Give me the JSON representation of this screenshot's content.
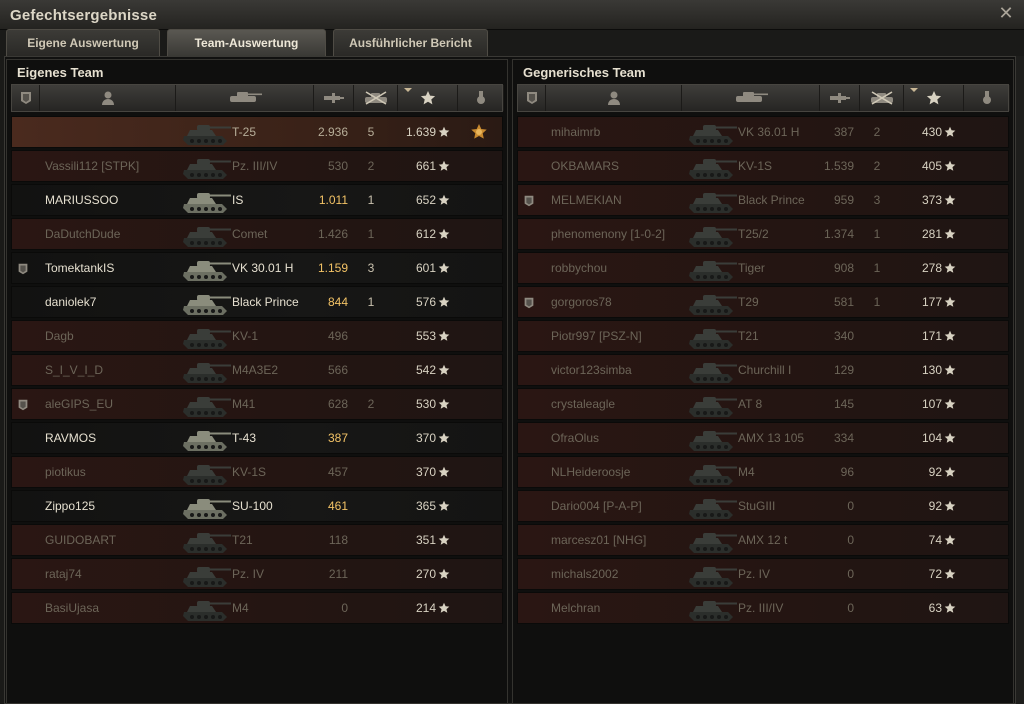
{
  "window": {
    "title": "Gefechtsergebnisse",
    "close_icon": "close-icon"
  },
  "tabs": [
    {
      "label": "Eigene Auswertung",
      "active": false
    },
    {
      "label": "Team-Auswertung",
      "active": true
    },
    {
      "label": "Ausführlicher Bericht",
      "active": false
    }
  ],
  "columns": [
    "badge-icon",
    "player-icon",
    "vehicle-icon",
    "damage-icon",
    "kills-icon",
    "xp-star-icon",
    "medal-icon"
  ],
  "colors": {
    "destroyed_row": "#2a1613",
    "alive_row": "#171716",
    "highlight_damage": "#f2c266",
    "panel_border": "#34332f"
  },
  "own_team": {
    "title": "Eigenes Team",
    "rows": [
      {
        "name": "",
        "vehicle": "T-25",
        "damage": "2.936",
        "kills": "5",
        "xp": "1.639",
        "status": "player",
        "badge": false,
        "medal": true,
        "dmg_hl": false
      },
      {
        "name": "Vassili112 [STPK]",
        "vehicle": "Pz. III/IV",
        "damage": "530",
        "kills": "2",
        "xp": "661",
        "status": "dead",
        "badge": false,
        "medal": false,
        "dmg_hl": false
      },
      {
        "name": "MARIUSSOO",
        "vehicle": "IS",
        "damage": "1.011",
        "kills": "1",
        "xp": "652",
        "status": "alive",
        "badge": false,
        "medal": false,
        "dmg_hl": true
      },
      {
        "name": "DaDutchDude",
        "vehicle": "Comet",
        "damage": "1.426",
        "kills": "1",
        "xp": "612",
        "status": "dead",
        "badge": false,
        "medal": false,
        "dmg_hl": false
      },
      {
        "name": "TomektankIS",
        "vehicle": "VK 30.01 H",
        "damage": "1.159",
        "kills": "3",
        "xp": "601",
        "status": "alive",
        "badge": true,
        "medal": false,
        "dmg_hl": true
      },
      {
        "name": "daniolek7",
        "vehicle": "Black Prince",
        "damage": "844",
        "kills": "1",
        "xp": "576",
        "status": "alive",
        "badge": false,
        "medal": false,
        "dmg_hl": true
      },
      {
        "name": "Dagb",
        "vehicle": "KV-1",
        "damage": "496",
        "kills": "",
        "xp": "553",
        "status": "dead",
        "badge": false,
        "medal": false,
        "dmg_hl": false
      },
      {
        "name": "S_I_V_I_D",
        "vehicle": "M4A3E2",
        "damage": "566",
        "kills": "",
        "xp": "542",
        "status": "dead",
        "badge": false,
        "medal": false,
        "dmg_hl": false
      },
      {
        "name": "aleGIPS_EU",
        "vehicle": "M41",
        "damage": "628",
        "kills": "2",
        "xp": "530",
        "status": "dead",
        "badge": true,
        "medal": false,
        "dmg_hl": false
      },
      {
        "name": "RAVMOS",
        "vehicle": "T-43",
        "damage": "387",
        "kills": "",
        "xp": "370",
        "status": "alive",
        "badge": false,
        "medal": false,
        "dmg_hl": true
      },
      {
        "name": "piotikus",
        "vehicle": "KV-1S",
        "damage": "457",
        "kills": "",
        "xp": "370",
        "status": "dead",
        "badge": false,
        "medal": false,
        "dmg_hl": false
      },
      {
        "name": "Zippo125",
        "vehicle": "SU-100",
        "damage": "461",
        "kills": "",
        "xp": "365",
        "status": "alive",
        "badge": false,
        "medal": false,
        "dmg_hl": true
      },
      {
        "name": "GUIDOBART",
        "vehicle": "T21",
        "damage": "118",
        "kills": "",
        "xp": "351",
        "status": "dead",
        "badge": false,
        "medal": false,
        "dmg_hl": false
      },
      {
        "name": "rataj74",
        "vehicle": "Pz. IV",
        "damage": "211",
        "kills": "",
        "xp": "270",
        "status": "dead",
        "badge": false,
        "medal": false,
        "dmg_hl": false
      },
      {
        "name": "BasiUjasa",
        "vehicle": "M4",
        "damage": "0",
        "kills": "",
        "xp": "214",
        "status": "dead",
        "badge": false,
        "medal": false,
        "dmg_hl": false
      }
    ]
  },
  "enemy_team": {
    "title": "Gegnerisches Team",
    "rows": [
      {
        "name": "mihaimrb",
        "vehicle": "VK 36.01 H",
        "damage": "387",
        "kills": "2",
        "xp": "430",
        "status": "dead",
        "badge": false,
        "medal": false,
        "dmg_hl": false
      },
      {
        "name": "OKBAMARS",
        "vehicle": "KV-1S",
        "damage": "1.539",
        "kills": "2",
        "xp": "405",
        "status": "dead",
        "badge": false,
        "medal": false,
        "dmg_hl": false
      },
      {
        "name": "MELMEKIAN",
        "vehicle": "Black Prince",
        "damage": "959",
        "kills": "3",
        "xp": "373",
        "status": "dead",
        "badge": true,
        "medal": false,
        "dmg_hl": false
      },
      {
        "name": "phenomenony [1-0-2]",
        "vehicle": "T25/2",
        "damage": "1.374",
        "kills": "1",
        "xp": "281",
        "status": "dead",
        "badge": false,
        "medal": false,
        "dmg_hl": false
      },
      {
        "name": "robbychou",
        "vehicle": "Tiger",
        "damage": "908",
        "kills": "1",
        "xp": "278",
        "status": "dead",
        "badge": false,
        "medal": false,
        "dmg_hl": false
      },
      {
        "name": "gorgoros78",
        "vehicle": "T29",
        "damage": "581",
        "kills": "1",
        "xp": "177",
        "status": "dead",
        "badge": true,
        "medal": false,
        "dmg_hl": false
      },
      {
        "name": "Piotr997 [PSZ-N]",
        "vehicle": "T21",
        "damage": "340",
        "kills": "",
        "xp": "171",
        "status": "dead",
        "badge": false,
        "medal": false,
        "dmg_hl": false
      },
      {
        "name": "victor123simba",
        "vehicle": "Churchill I",
        "damage": "129",
        "kills": "",
        "xp": "130",
        "status": "dead",
        "badge": false,
        "medal": false,
        "dmg_hl": false
      },
      {
        "name": "crystaleagle",
        "vehicle": "AT 8",
        "damage": "145",
        "kills": "",
        "xp": "107",
        "status": "dead",
        "badge": false,
        "medal": false,
        "dmg_hl": false
      },
      {
        "name": "OfraOlus",
        "vehicle": "AMX 13 105",
        "damage": "334",
        "kills": "",
        "xp": "104",
        "status": "dead",
        "badge": false,
        "medal": false,
        "dmg_hl": false
      },
      {
        "name": "NLHeideroosje",
        "vehicle": "M4",
        "damage": "96",
        "kills": "",
        "xp": "92",
        "status": "dead",
        "badge": false,
        "medal": false,
        "dmg_hl": false
      },
      {
        "name": "Dario004 [P-A-P]",
        "vehicle": "StuGIII",
        "damage": "0",
        "kills": "",
        "xp": "92",
        "status": "dead",
        "badge": false,
        "medal": false,
        "dmg_hl": false
      },
      {
        "name": "marcesz01 [NHG]",
        "vehicle": "AMX 12 t",
        "damage": "0",
        "kills": "",
        "xp": "74",
        "status": "dead",
        "badge": false,
        "medal": false,
        "dmg_hl": false
      },
      {
        "name": "michals2002",
        "vehicle": "Pz. IV",
        "damage": "0",
        "kills": "",
        "xp": "72",
        "status": "dead",
        "badge": false,
        "medal": false,
        "dmg_hl": false
      },
      {
        "name": "Melchran",
        "vehicle": "Pz. III/IV",
        "damage": "0",
        "kills": "",
        "xp": "63",
        "status": "dead",
        "badge": false,
        "medal": false,
        "dmg_hl": false
      }
    ]
  }
}
